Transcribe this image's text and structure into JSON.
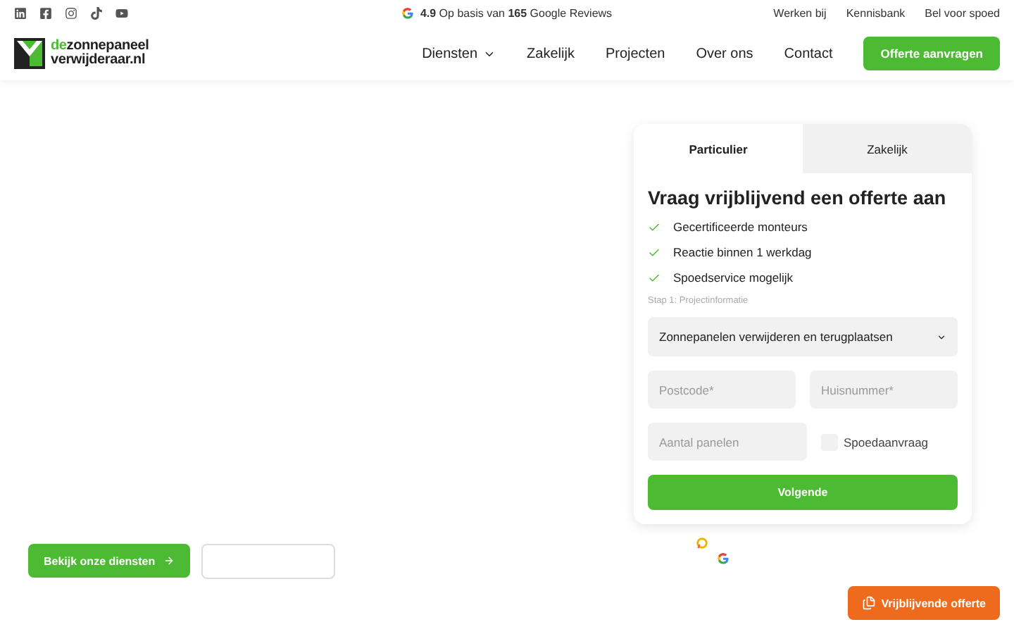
{
  "topbar": {
    "social": [
      {
        "kind": "linkedin"
      },
      {
        "kind": "facebook"
      },
      {
        "kind": "instagram"
      },
      {
        "kind": "tiktok"
      },
      {
        "kind": "youtube"
      }
    ],
    "rating": "**4.9** Op basis van **165** Google Reviews",
    "links": [
      "Werken bij",
      "Kennisbank",
      "Bel voor spoed"
    ]
  },
  "header": {
    "logo": {
      "prefix": "de",
      "line1": "zonnepaneel",
      "line2": "verwijderaar.nl"
    },
    "nav": [
      {
        "label": "Diensten",
        "dropdown": true
      },
      {
        "label": "Zakelijk",
        "dropdown": false
      },
      {
        "label": "Projecten",
        "dropdown": false
      },
      {
        "label": "Over ons",
        "dropdown": false
      },
      {
        "label": "Contact",
        "dropdown": false
      }
    ],
    "cta": "Offerte aanvragen"
  },
  "hero": {
    "primary_button": "Bekijk onze diensten"
  },
  "form": {
    "tabs": [
      {
        "label": "Particulier",
        "selected": true
      },
      {
        "label": "Zakelijk",
        "selected": false
      }
    ],
    "title": "Vraag vrijblijvend een offerte aan",
    "benefits": [
      "Gecertificeerde monteurs",
      "Reactie binnen 1 werkdag",
      "Spoedservice mogelijk"
    ],
    "step": "Stap 1: Projectinformatie",
    "service": "Zonnepanelen verwijderen en terugplaatsen",
    "postcode": {
      "placeholder": "Postcode*"
    },
    "huisnummer": {
      "placeholder": "Huisnummer*"
    },
    "panelen": {
      "placeholder": "Aantal panelen"
    },
    "spoed": {
      "label": "Spoedaanvraag",
      "checked": false
    },
    "submit": "Volgende"
  },
  "floating": {
    "label": "Vrijblijvende offerte"
  }
}
